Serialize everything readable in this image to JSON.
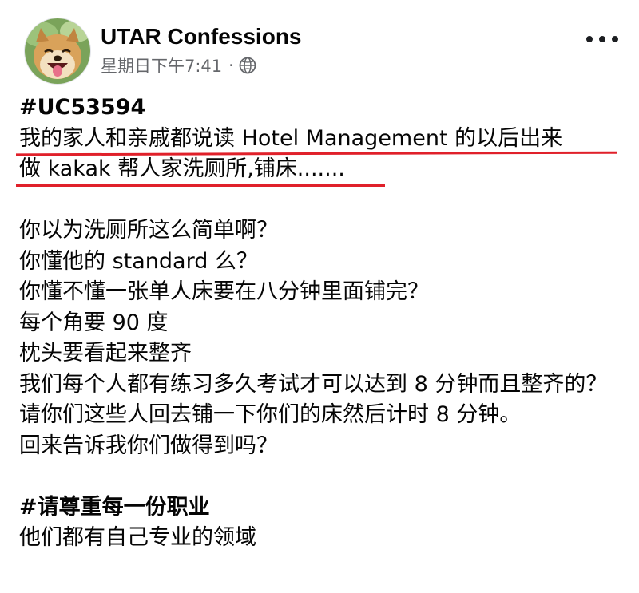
{
  "post": {
    "author": "UTAR Confessions",
    "timestamp": "星期日下午7:41",
    "separator": "·",
    "privacy_icon": "globe-icon",
    "more_icon": "more-options-icon",
    "avatar_desc": "avatar"
  },
  "body": {
    "tag_line": "#UC53594",
    "highlight_line_1": "我的家人和亲戚都说读 Hotel Management 的以后出来",
    "highlight_line_2": "做 kakak 帮人家洗厕所,铺床.......",
    "lines": [
      "你以为洗厕所这么简单啊？",
      "你懂他的 standard 么？",
      "你懂不懂一张单人床要在八分钟里面铺完？",
      "每个角要 90 度",
      "枕头要看起来整齐",
      "我们每个人都有练习多久考试才可以达到 8 分钟而且整齐的？",
      "请你们这些人回去铺一下你们的床然后计时 8 分钟。",
      "回来告诉我你们做得到吗？"
    ],
    "hashtag_2": "#请尊重每一份职业",
    "last_line": "他们都有自己专业的领域"
  },
  "colors": {
    "underline": "#e0202a",
    "meta_text": "#65676b",
    "text": "#050505"
  }
}
